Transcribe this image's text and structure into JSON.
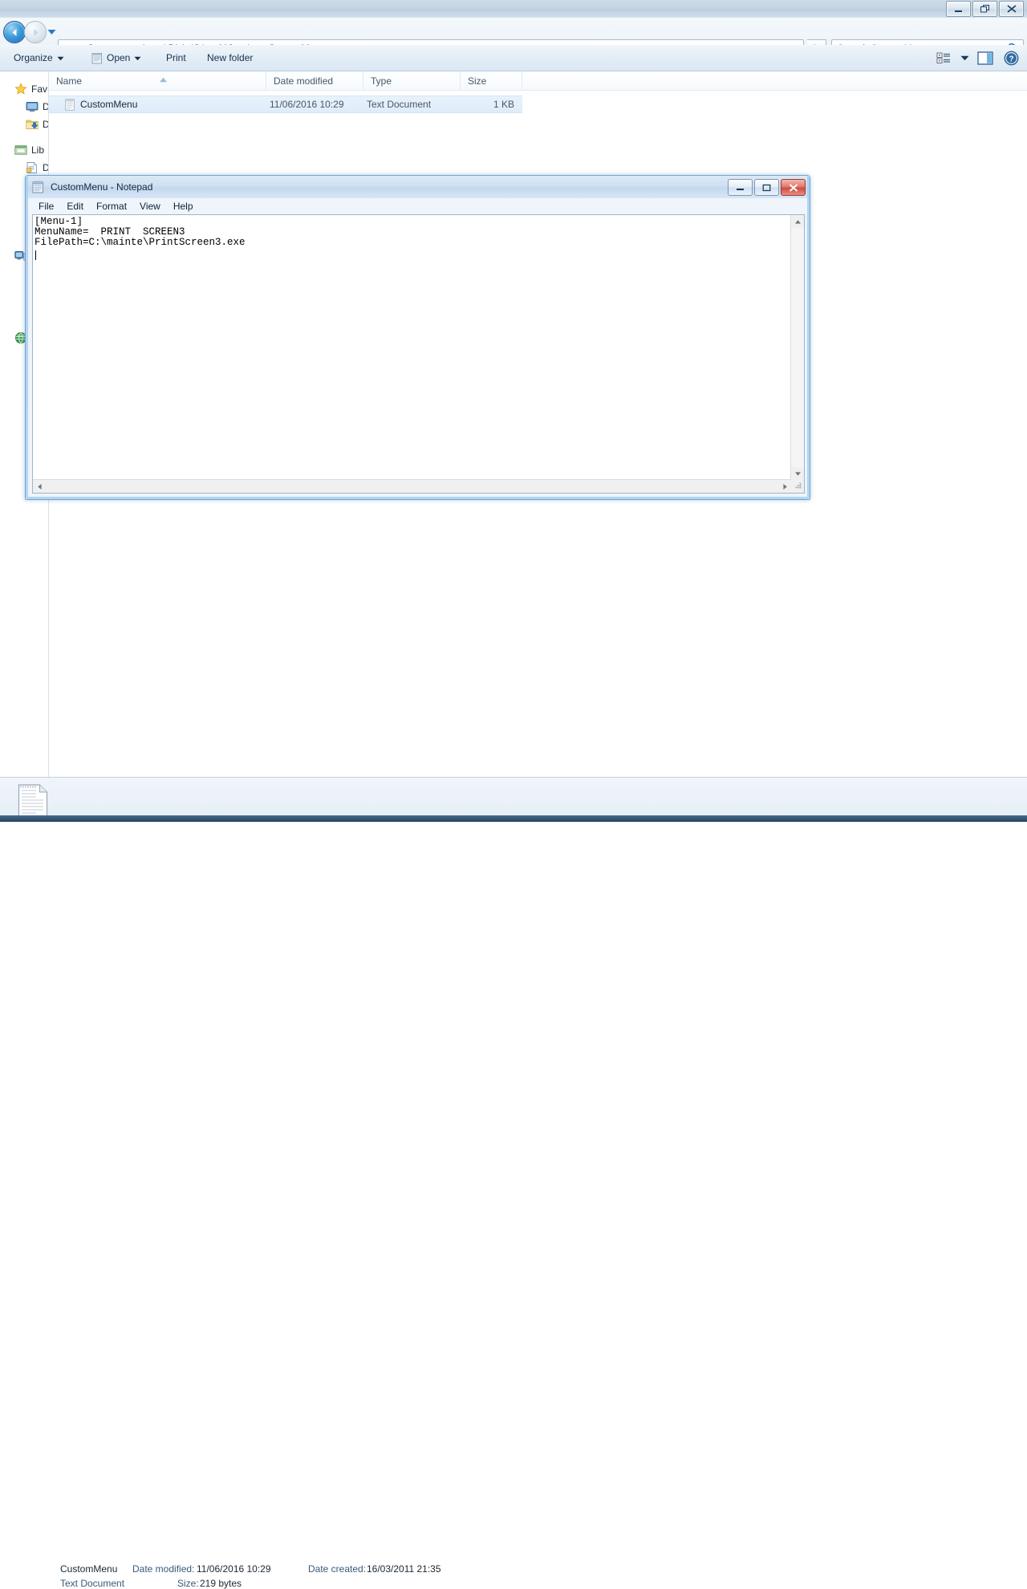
{
  "explorer": {
    "window_buttons": [
      {
        "name": "minimize",
        "glyph": "minimize-icon"
      },
      {
        "name": "restore",
        "glyph": "restore-icon"
      },
      {
        "name": "close",
        "glyph": "close-icon"
      }
    ],
    "address": {
      "crumbs": [
        "Computer",
        "Local Disk (C:)",
        "MC_sdg",
        "CustomMenu"
      ],
      "separator": "▸"
    },
    "search": {
      "placeholder": "Search CustomMenu",
      "value": ""
    },
    "toolbar": {
      "organize_label": "Organize",
      "open_label": "Open",
      "print_label": "Print",
      "new_folder_label": "New folder",
      "caret": "▼"
    },
    "nav_pane": {
      "items": [
        {
          "label": "Fav",
          "icon": "star-icon",
          "indent": 0
        },
        {
          "label": "D",
          "icon": "desktop-icon",
          "indent": 1
        },
        {
          "label": "D",
          "icon": "downloads-icon",
          "indent": 1
        },
        {
          "label": "Lib",
          "icon": "libraries-icon",
          "indent": 0
        },
        {
          "label": "D",
          "icon": "documents-icon",
          "indent": 1
        },
        {
          "label": "",
          "icon": "computer-icon",
          "indent": 0
        },
        {
          "label": "",
          "icon": "network-icon",
          "indent": 0
        }
      ]
    },
    "columns": [
      {
        "label": "Name",
        "key": "name"
      },
      {
        "label": "Date modified",
        "key": "date"
      },
      {
        "label": "Type",
        "key": "type"
      },
      {
        "label": "Size",
        "key": "size"
      }
    ],
    "sort": {
      "column": "Name",
      "direction": "ascending",
      "glyph": "sort-asc-icon"
    },
    "rows": [
      {
        "name": "CustomMenu",
        "date": "11/06/2016 10:29",
        "type": "Text Document",
        "size": "1 KB",
        "icon": "text-document-icon",
        "selected": true
      }
    ],
    "details": {
      "file_name": "CustomMenu",
      "file_type": "Text Document",
      "date_modified_label": "Date modified:",
      "date_modified_value": "11/06/2016 10:29",
      "date_created_label": "Date created:",
      "date_created_value": "16/03/2011 21:35",
      "size_label": "Size:",
      "size_value": "219 bytes",
      "icon": "text-document-large-icon"
    }
  },
  "notepad": {
    "title": "CustomMenu - Notepad",
    "icon": "notepad-icon",
    "menus": [
      "File",
      "Edit",
      "Format",
      "View",
      "Help"
    ],
    "window_buttons": [
      {
        "name": "minimize",
        "glyph": "minimize-icon"
      },
      {
        "name": "maximize",
        "glyph": "maximize-icon"
      },
      {
        "name": "close",
        "glyph": "close-icon"
      }
    ],
    "content": "[Menu-1]\nMenuName=  PRINT  SCREEN3\nFilePath=C:\\mainte\\PrintScreen3.exe\n"
  },
  "colors": {
    "accent": "#2a6fb5",
    "selection": "#e2edf9",
    "close_red": "#cf4c3c",
    "frame_blue": "#6ca6d9"
  }
}
